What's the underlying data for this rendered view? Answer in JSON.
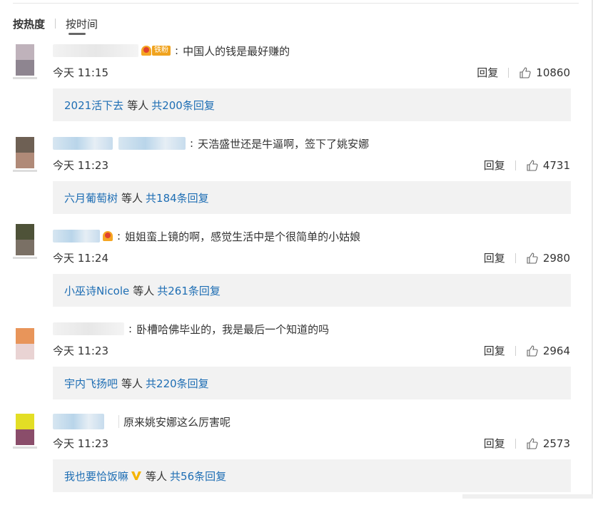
{
  "sort": {
    "hot_label": "按热度",
    "time_label": "按时间"
  },
  "comments": [
    {
      "text": "中国人的钱是最好赚的",
      "time": "今天 11:15",
      "reply_label": "回复",
      "likes": "10860",
      "badge_tag": "铁粉",
      "reply_user": "2021活下去",
      "reply_etc": "等人",
      "reply_count": "共200条回复",
      "avatar_colors": [
        "#bfb2bb",
        "#8e8590"
      ]
    },
    {
      "text": "天浩盛世还是牛逼啊，签下了姚安娜",
      "time": "今天 11:23",
      "reply_label": "回复",
      "likes": "4731",
      "reply_user": "六月葡萄树",
      "reply_etc": "等人",
      "reply_count": "共184条回复",
      "avatar_colors": [
        "#6e6054",
        "#b08a78"
      ]
    },
    {
      "text": "姐姐蛮上镜的啊，感觉生活中是个很简单的小姑娘",
      "time": "今天 11:24",
      "reply_label": "回复",
      "likes": "2980",
      "reply_user": "小巫诗Nicole",
      "reply_etc": "等人",
      "reply_count": "共261条回复",
      "avatar_colors": [
        "#4e5238",
        "#7a7065"
      ]
    },
    {
      "text": "卧槽哈佛毕业的，我是最后一个知道的吗",
      "time": "今天 11:23",
      "reply_label": "回复",
      "likes": "2964",
      "reply_user": "宇内飞扬吧",
      "reply_etc": "等人",
      "reply_count": "共220条回复",
      "avatar_colors": [
        "#e8955a",
        "#e9d3d3"
      ]
    },
    {
      "text": "原来姚安娜这么厉害呢",
      "time": "今天 11:23",
      "reply_label": "回复",
      "likes": "2573",
      "reply_user": "我也要恰饭嘛",
      "reply_etc": "等人",
      "reply_count": "共56条回复",
      "avatar_colors": [
        "#e3de25",
        "#8a4d6a"
      ]
    }
  ],
  "colors": {
    "link": "#1e6eb4",
    "reply_bg": "#f2f2f2",
    "badge": "#f0a31e",
    "vip": "#f5b400"
  },
  "icons": {
    "like": "thumbs-up-icon",
    "fan_badge": "fan-badge-icon",
    "vip": "vip-v-icon"
  }
}
